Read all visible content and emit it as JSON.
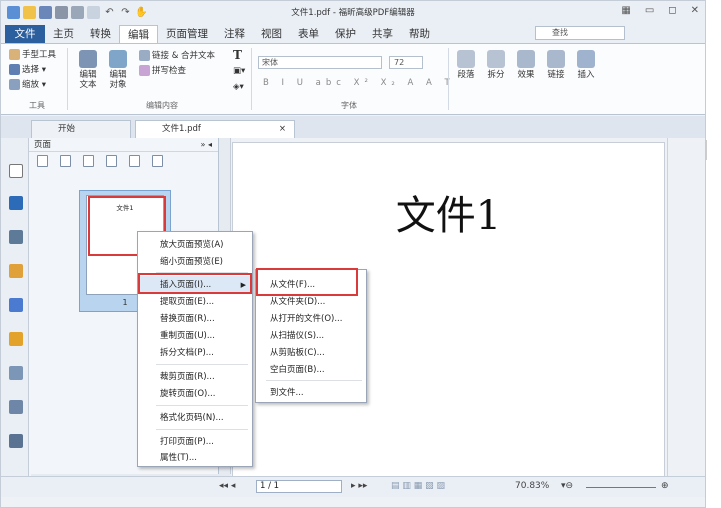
{
  "window": {
    "title": "文件1.pdf - 福昕高级PDF编辑器",
    "quick_access_icons": [
      "app-icon",
      "open-icon",
      "save-icon",
      "print-icon",
      "print-preview-icon",
      "new-icon",
      "undo-icon",
      "redo-icon",
      "hand-icon",
      "customize-icon"
    ]
  },
  "menu": {
    "tabs": [
      "文件",
      "主页",
      "转换",
      "编辑",
      "页面管理",
      "注释",
      "视图",
      "表单",
      "保护",
      "共享",
      "帮助"
    ],
    "active_tab": "编辑",
    "search_placeholder": "查找"
  },
  "ribbon": {
    "tools": {
      "items": [
        "手型工具",
        "选择",
        "缩放"
      ],
      "group_label": "工具"
    },
    "edit": {
      "edit_text": "编辑\n文本",
      "edit_object": "编辑\n对象",
      "link_merge": "链接 & 合并文本",
      "spell_check": "拼写检查",
      "group_label": "编辑内容"
    },
    "font": {
      "font_name": "宋体",
      "font_size": "72",
      "format_buttons": "B I U abc X² X₂ A A T",
      "group_label": "字体"
    },
    "paragraph": {
      "items": [
        "段落",
        "拆分",
        "效果",
        "链接",
        "插入"
      ]
    }
  },
  "doc_tabs": {
    "start": "开始",
    "file": "文件1.pdf",
    "close": "×"
  },
  "side_panel": {
    "title": "页面",
    "thumb_title": "文件1",
    "page_number": "1"
  },
  "page": {
    "title": "文件1"
  },
  "context_menu": {
    "items": [
      "放大页面预览(A)",
      "缩小页面预览(E)",
      "插入页面(I)...",
      "提取页面(E)...",
      "替换页面(R)...",
      "重制页面(U)...",
      "拆分文档(P)...",
      "裁剪页面(R)...",
      "旋转页面(O)...",
      "格式化页码(N)...",
      "打印页面(P)...",
      "属性(T)..."
    ],
    "highlighted": "插入页面(I)..."
  },
  "submenu": {
    "items": [
      "从文件(F)...",
      "从文件夹(D)...",
      "从打开的文件(O)...",
      "从扫描仪(S)...",
      "从剪贴板(C)...",
      "空白页面(B)...",
      "到文件..."
    ]
  },
  "status": {
    "page_field": "1 / 1",
    "zoom": "70.83%"
  },
  "colors": {
    "accent": "#2c5f9e",
    "highlight_red": "#d93a3a",
    "menu_highlight": "#dde8f6"
  }
}
